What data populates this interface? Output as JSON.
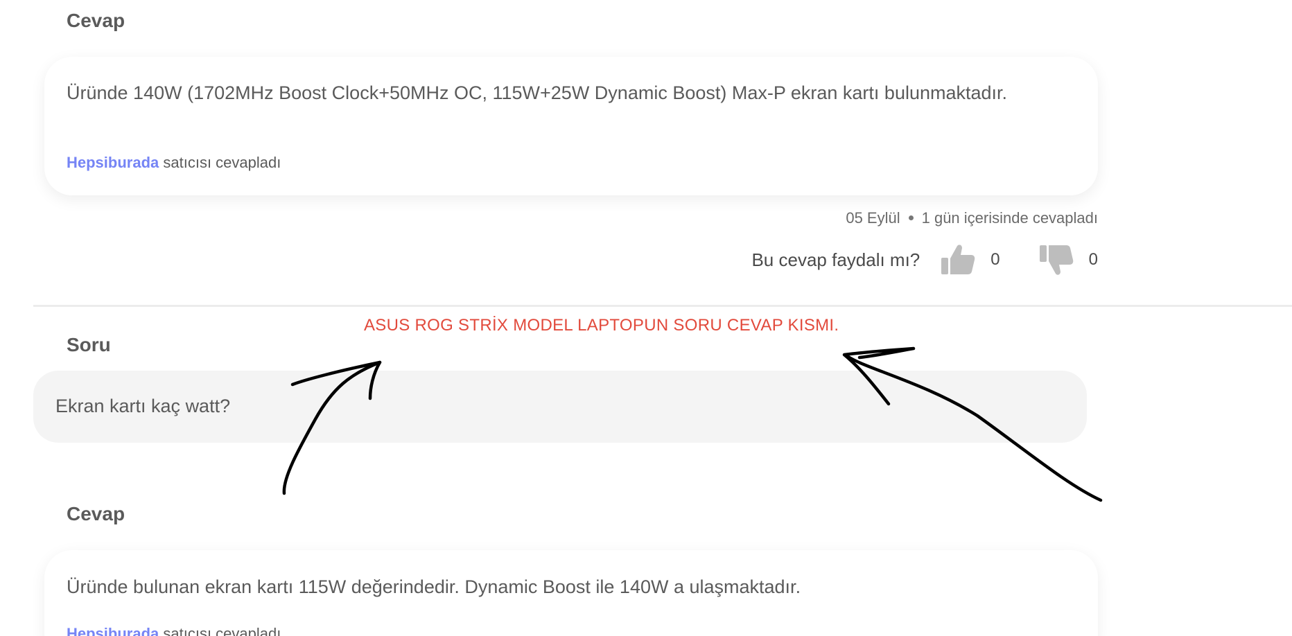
{
  "answer1": {
    "label": "Cevap",
    "text": "Üründe 140W (1702MHz Boost Clock+50MHz OC, 115W+25W Dynamic Boost) Max-P ekran kartı bulunmaktadır.",
    "seller_name": "Hepsiburada",
    "seller_suffix": " satıcısı cevapladı",
    "date": "05 Eylül",
    "response_time": "1 gün içerisinde cevapladı",
    "helpful_question": "Bu cevap faydalı mı?",
    "thumbs_up_count": "0",
    "thumbs_down_count": "0"
  },
  "annotation": {
    "text": "ASUS ROG STRİX MODEL LAPTOPUN SORU CEVAP KISMI.",
    "color": "#e24a3c"
  },
  "question": {
    "label": "Soru",
    "text": "Ekran kartı kaç watt?"
  },
  "answer2": {
    "label": "Cevap",
    "text": "Üründe bulunan ekran kartı 115W değerindedir. Dynamic Boost ile 140W a ulaşmaktadır.",
    "seller_name": "Hepsiburada",
    "seller_suffix": " satıcısı cevapladı"
  },
  "colors": {
    "seller_link": "#7584f5",
    "question_bg": "#f4f4f4",
    "icon_gray": "#bdbdbd"
  }
}
